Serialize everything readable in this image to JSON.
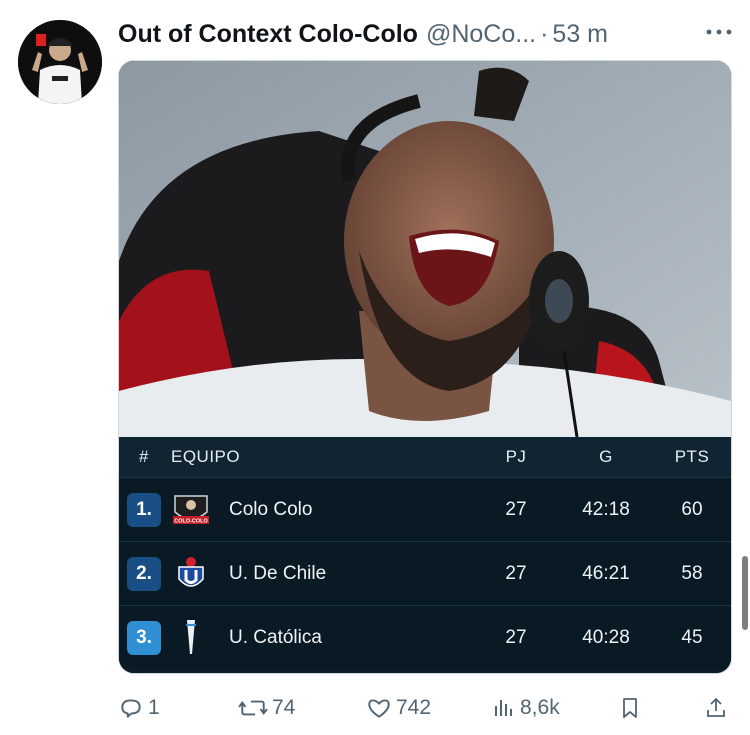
{
  "tweet": {
    "display_name": "Out of Context Colo-Colo",
    "handle": "@NoCo...",
    "separator": "·",
    "time": "53 m"
  },
  "standings": {
    "headers": {
      "rank": "#",
      "team": "EQUIPO",
      "pj": "PJ",
      "g": "G",
      "pts": "PTS"
    },
    "rows": [
      {
        "pos": "1.",
        "team": "Colo Colo",
        "pj": "27",
        "g": "42:18",
        "pts": "60",
        "pos_color": "#1a4f86",
        "crest_text": "COLO-COLO"
      },
      {
        "pos": "2.",
        "team": "U. De Chile",
        "pj": "27",
        "g": "46:21",
        "pts": "58",
        "pos_color": "#1a4f86"
      },
      {
        "pos": "3.",
        "team": "U. Católica",
        "pj": "27",
        "g": "40:28",
        "pts": "45",
        "pos_color": "#2f8fd2"
      }
    ]
  },
  "actions": {
    "reply_count": "1",
    "repost_count": "74",
    "like_count": "742",
    "view_count": "8,6k"
  },
  "icons": {
    "reply": "reply-icon",
    "repost": "repost-icon",
    "like": "heart-icon",
    "views": "views-icon",
    "bookmark": "bookmark-icon",
    "share": "share-icon",
    "more": "more-icon"
  },
  "colors": {
    "secondary_text": "#536471",
    "table_bg": "#0c1d28"
  }
}
